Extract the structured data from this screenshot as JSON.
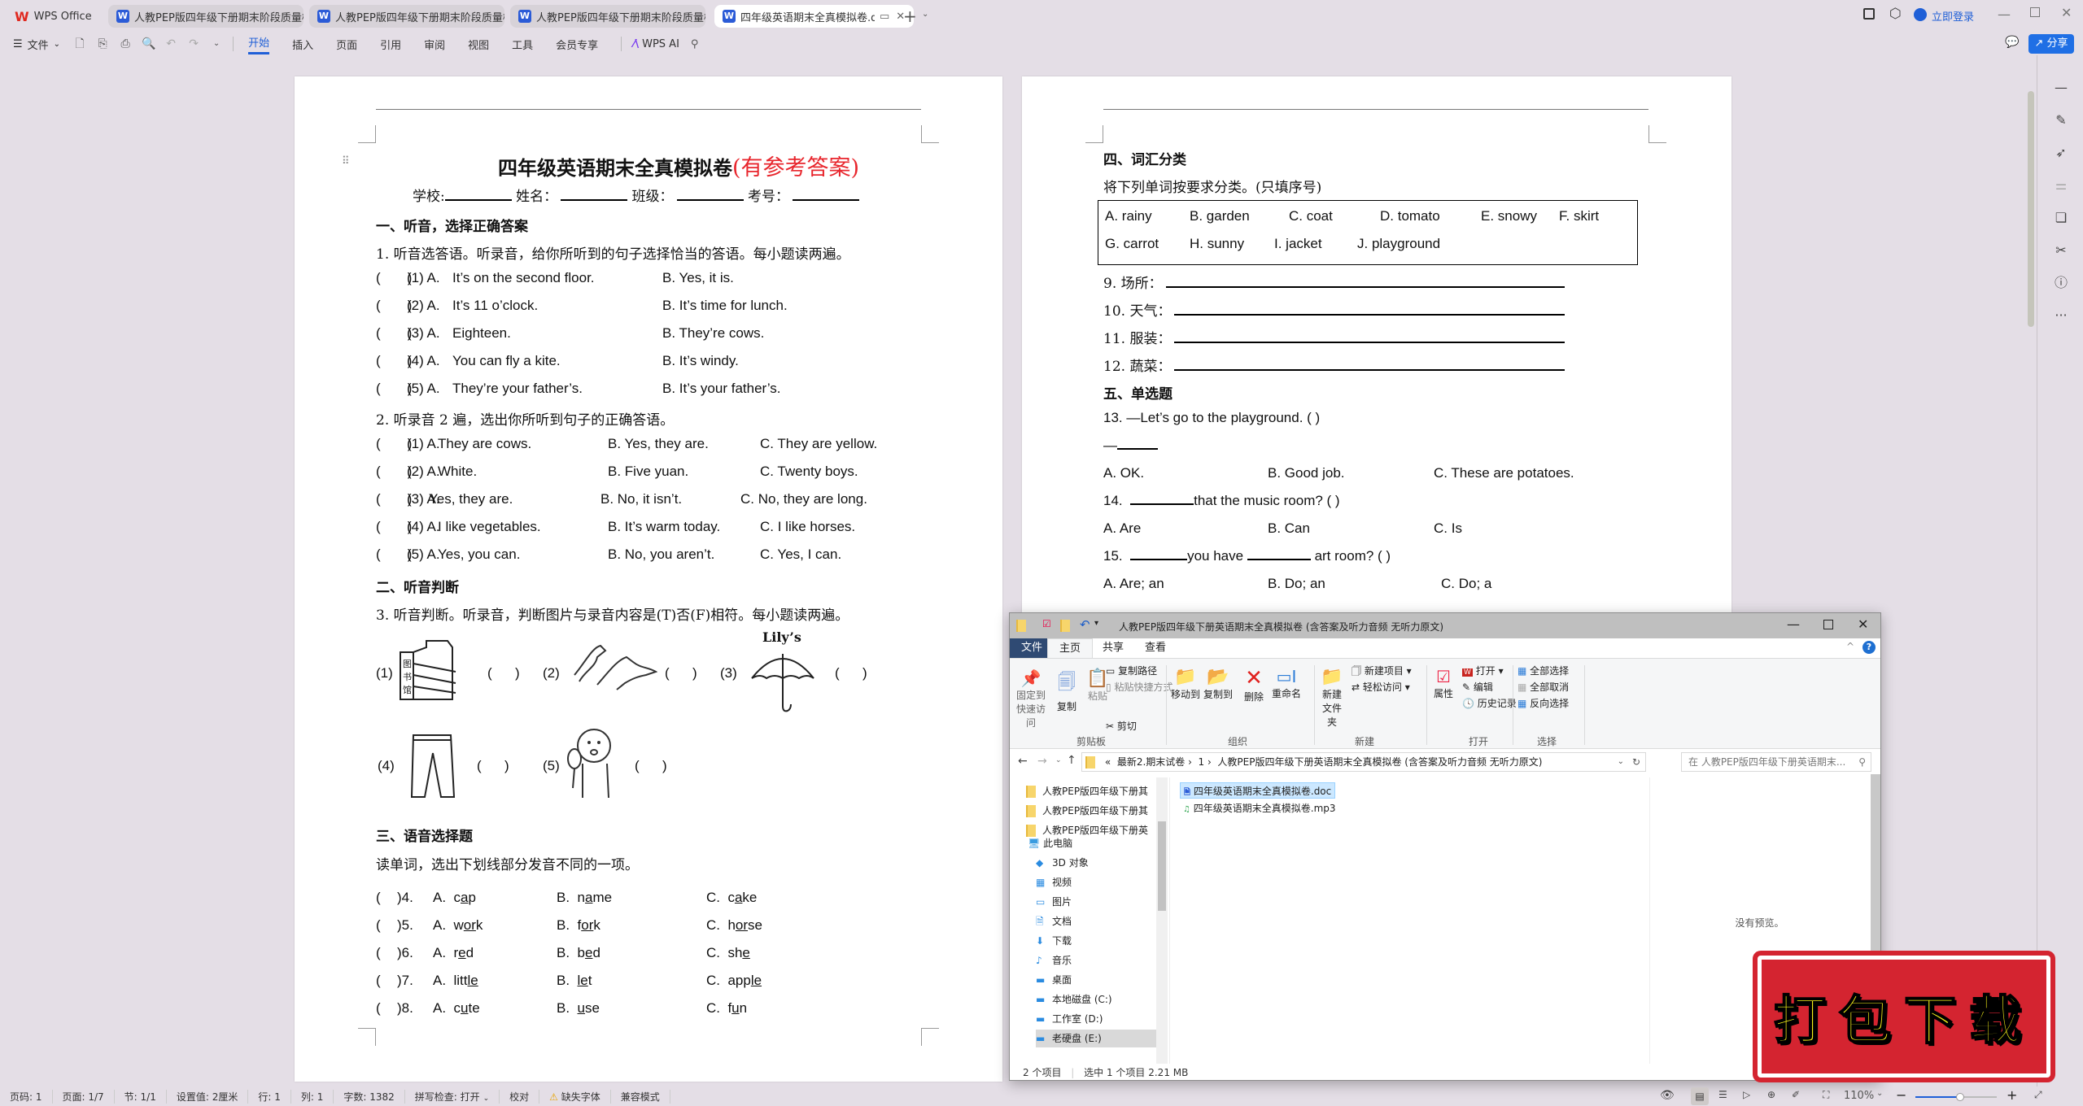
{
  "tabs": [
    {
      "label": "WPS Office",
      "icon": "wps-logo-icon",
      "active": false
    },
    {
      "label": "人教PEP版四年级下册期末阶段质量检",
      "icon": "word-doc-icon",
      "active": false
    },
    {
      "label": "人教PEP版四年级下册期末阶段质量检",
      "icon": "word-doc-icon",
      "active": false
    },
    {
      "label": "人教PEP版四年级下册期末阶段质量检",
      "icon": "word-doc-icon",
      "active": false
    },
    {
      "label": "四年级英语期末全真模拟卷.doc",
      "icon": "word-doc-icon",
      "active": true
    }
  ],
  "titlebar": {
    "login": "立即登录",
    "share": "分享"
  },
  "menu": {
    "file": "文件",
    "items": [
      "开始",
      "插入",
      "页面",
      "引用",
      "审阅",
      "视图",
      "工具",
      "会员专享"
    ],
    "selected": "开始",
    "ai": "WPS AI"
  },
  "page1": {
    "title": "四年级英语期末全真模拟卷",
    "title_red": "(有参考答案)",
    "info": {
      "school": "学校:",
      "name": "姓名：",
      "class": "班级：",
      "number": "考号："
    },
    "sec1": "一、听音，选择正确答案",
    "q1": "1.  听音选答语。听录音，给你所听到的句子选择恰当的答语。每小题读两遍。",
    "q1_items": [
      {
        "n": "(1) A.",
        "a": "It’s on the second floor.",
        "b": "B.  Yes, it is."
      },
      {
        "n": "(2) A.",
        "a": "It’s 11 o’clock.",
        "b": "B.  It’s time for lunch."
      },
      {
        "n": "(3) A.",
        "a": "Eighteen.",
        "b": "B.  They’re cows."
      },
      {
        "n": "(4) A.",
        "a": "You can fly a kite.",
        "b": "B.  It’s windy."
      },
      {
        "n": "(5) A.",
        "a": "They’re your father’s.",
        "b": "B.  It’s your father’s."
      }
    ],
    "q2": "2.  听录音 2 遍，选出你所听到句子的正确答语。",
    "q2_items": [
      {
        "n": "(1) A.",
        "a": "They are cows.",
        "b": "B.  Yes, they are.",
        "c": "C.    They are yellow."
      },
      {
        "n": "(2) A.",
        "a": "White.",
        "b": "B.  Five yuan.",
        "c": "C.    Twenty boys."
      },
      {
        "n": "(3) A.",
        "a": "Yes, they are.",
        "b": "B. No, it isn’t.",
        "c": "C.  No, they are long."
      },
      {
        "n": "(4) A.",
        "a": "I like vegetables.",
        "b": "B.  It’s warm today.",
        "c": "C.    I like horses."
      },
      {
        "n": "(5) A.",
        "a": "Yes, you can.",
        "b": "B.  No, you aren’t.",
        "c": "C.    Yes, I can."
      }
    ],
    "sec2": "二、听音判断",
    "q3": "3.  听音判断。听录音，判断图片与录音内容是(T)否(F)相符。每小题读两遍。",
    "q3_pics": [
      {
        "n": "(1)",
        "pic": "library-building-image",
        "caption": "图书馆"
      },
      {
        "n": "(2)",
        "pic": "horses-image"
      },
      {
        "n": "(3)",
        "pic": "umbrella-image",
        "caption": "Lily’s"
      },
      {
        "n": "(4)",
        "pic": "trousers-image"
      },
      {
        "n": "(5)",
        "pic": "hot-girl-with-fan-image"
      }
    ],
    "sec3": "三、语音选择题",
    "q4_intro": "读单词，选出下划线部分发音不同的一项。",
    "phonics": [
      {
        "n": ")4.",
        "a": [
          "c",
          "a",
          "p"
        ],
        "b": [
          "n",
          "a",
          "me"
        ],
        "c": [
          "c",
          "a",
          "ke"
        ]
      },
      {
        "n": ")5.",
        "a": [
          "w",
          "or",
          "k"
        ],
        "b": [
          "f",
          "or",
          "k"
        ],
        "c": [
          "h",
          "or",
          "se"
        ]
      },
      {
        "n": ")6.",
        "a": [
          "r",
          "e",
          "d"
        ],
        "b": [
          "b",
          "e",
          "d"
        ],
        "c": [
          "sh",
          "e",
          ""
        ]
      },
      {
        "n": ")7.",
        "a": [
          "litt",
          "le",
          ""
        ],
        "b": [
          "",
          "le",
          "t"
        ],
        "c": [
          "app",
          "le",
          ""
        ]
      },
      {
        "n": ")8.",
        "a": [
          "c",
          "u",
          "te"
        ],
        "b": [
          "",
          "u",
          "se"
        ],
        "c": [
          "f",
          "u",
          "n"
        ]
      }
    ]
  },
  "page2": {
    "sec4": "四、词汇分类",
    "intro": "将下列单词按要求分类。(只填序号)",
    "words_row1": [
      "A.  rainy",
      "B.  garden",
      "C.    coat",
      "D.  tomato",
      "E. snowy",
      "F. skirt"
    ],
    "words_row2": [
      "G. carrot",
      "H. sunny",
      "I. jacket",
      "J. playground"
    ],
    "categories": [
      "9.  场所：",
      "10.  天气：",
      "11.  服装：",
      "12.  蔬菜："
    ],
    "sec5": "五、单选题",
    "q13": "13.  —Let’s go to the playground. (        )",
    "q13_dash": "—",
    "q13_opts": [
      "A.  OK.",
      "B.  Good job.",
      "C.  These are potatoes."
    ],
    "q14_num": "14.",
    "q14_text": "that the music room? (        )",
    "q14_opts": [
      "A.  Are",
      "B.  Can",
      "C.  Is"
    ],
    "q15_num": "15.",
    "q15_mid": "you have",
    "q15_end": "art room? (        )",
    "q15_opts": [
      "A.  Are; an",
      "B.  Do; an",
      "C.  Do; a"
    ]
  },
  "explorer": {
    "title": "人教PEP版四年级下册英语期末全真模拟卷    (含答案及听力音频 无听力原文)",
    "ribbon_tabs": [
      "文件",
      "主页",
      "共享",
      "查看"
    ],
    "clipboard": {
      "pin": "固定到快速访问",
      "copy": "复制",
      "paste": "粘贴",
      "copy_path": "复制路径",
      "paste_shortcut": "粘贴快捷方式",
      "cut": "剪切",
      "group": "剪贴板"
    },
    "organize": {
      "move_to": "移动到",
      "copy_to": "复制到",
      "delete": "删除",
      "rename": "重命名",
      "group": "组织"
    },
    "new": {
      "new_folder": "新建文件夹",
      "new_item": "新建项目",
      "easy_access": "轻松访问",
      "group": "新建"
    },
    "open": {
      "properties": "属性",
      "open": "打开",
      "edit": "编辑",
      "history": "历史记录",
      "group": "打开"
    },
    "select": {
      "all": "全部选择",
      "none": "全部取消",
      "invert": "反向选择",
      "group": "选择"
    },
    "breadcrumb": [
      "«",
      "最新2.期末试卷",
      "1",
      "人教PEP版四年级下册英语期末全真模拟卷    (含答案及听力音频 无听力原文)"
    ],
    "search_placeholder": "在 人教PEP版四年级下册英语期末...",
    "nav_folders": [
      "人教PEP版四年级下册其",
      "人教PEP版四年级下册其",
      "人教PEP版四年级下册英"
    ],
    "nav_pc": "此电脑",
    "nav_items": [
      "3D 对象",
      "视频",
      "图片",
      "文档",
      "下载",
      "音乐",
      "桌面",
      "本地磁盘 (C:)",
      "工作室 (D:)",
      "老硬盘 (E:)"
    ],
    "files": [
      {
        "name": "四年级英语期末全真模拟卷.doc",
        "icon": "word-file-icon",
        "selected": true
      },
      {
        "name": "四年级英语期末全真模拟卷.mp3",
        "icon": "audio-file-icon",
        "selected": false
      }
    ],
    "preview": "没有预览。",
    "status": {
      "count": "2 个项目",
      "selected": "选中 1 个项目  2.21 MB"
    }
  },
  "stamp": "打包下载",
  "statusbar": {
    "items": [
      "页码: 1",
      "页面: 1/7",
      "节: 1/1",
      "设置值: 2厘米",
      "行: 1",
      "列: 1",
      "字数: 1382",
      "拼写检查: 打开",
      "校对",
      "缺失字体",
      "兼容模式"
    ],
    "zoom": "110%",
    "zoom_fraction": 0.55
  },
  "colors": {
    "accent": "#1f5fd7",
    "title_red": "#e8262d",
    "stamp_red": "#d42430",
    "stamp_text": "#f6f21a"
  }
}
